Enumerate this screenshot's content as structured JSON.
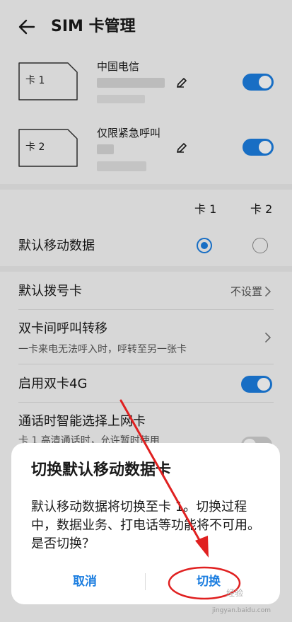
{
  "header": {
    "title": "SIM 卡管理"
  },
  "sim_cards": [
    {
      "card_label": "卡 1",
      "carrier": "中国电信",
      "enabled": true
    },
    {
      "card_label": "卡 2",
      "carrier": "仅限紧急呼叫",
      "enabled": true
    }
  ],
  "default_data": {
    "col_card1": "卡 1",
    "col_card2": "卡 2",
    "label": "默认移动数据",
    "selected": "卡 1"
  },
  "settings": {
    "default_dial": {
      "label": "默认拨号卡",
      "value": "不设置"
    },
    "call_forward": {
      "label": "双卡间呼叫转移",
      "sub": "一卡来电无法呼入时，呼转至另一张卡"
    },
    "dual_4g": {
      "label": "启用双卡4G",
      "enabled": true
    },
    "smart_select": {
      "label": "通话时智能选择上网卡",
      "sub": "卡 1 高清通话时，允许暂时使用",
      "enabled": false
    }
  },
  "dialog": {
    "title": "切换默认移动数据卡",
    "body": "默认移动数据将切换至卡 1。切换过程中，数据业务、打电话等功能将不可用。是否切换？",
    "cancel_label": "取消",
    "confirm_label": "切换"
  },
  "watermark": {
    "mark": "经验",
    "url": "jingyan.baidu.com"
  },
  "colors": {
    "accent": "#1c7ee0",
    "annotation": "#e02020"
  }
}
